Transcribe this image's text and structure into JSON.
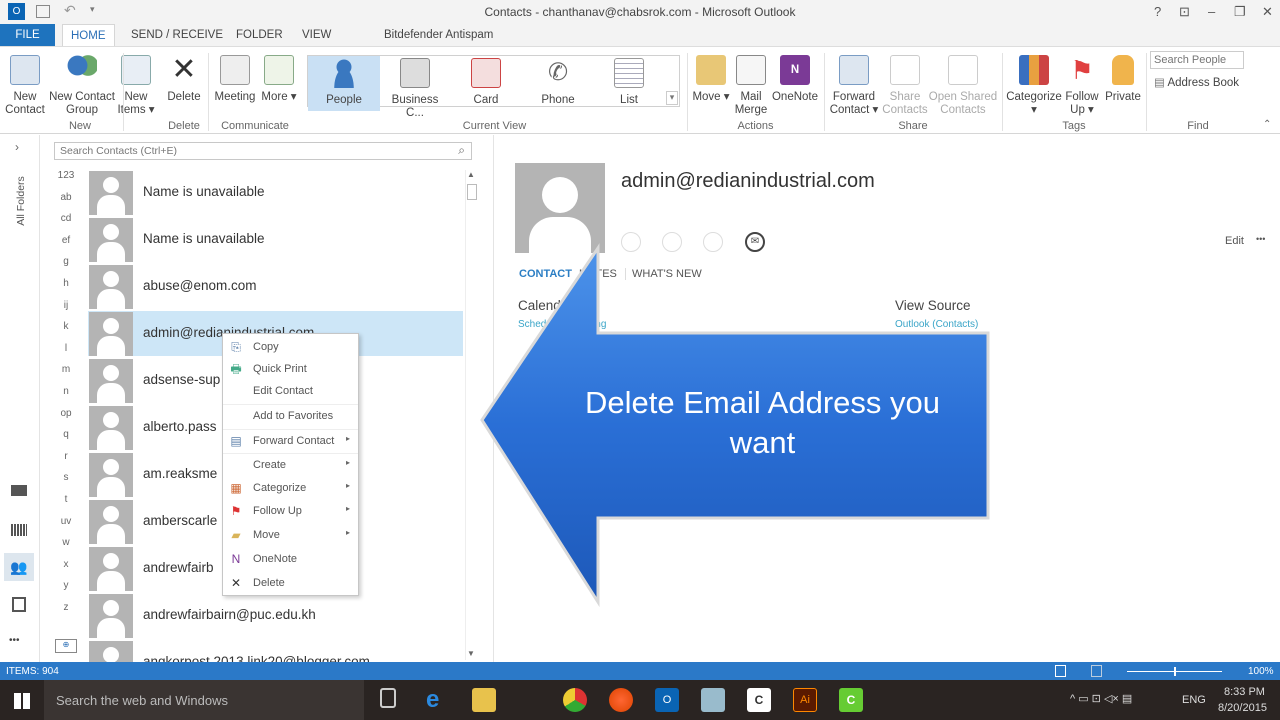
{
  "window": {
    "title": "Contacts - chanthanav@chabsrok.com - Microsoft Outlook",
    "help": "?",
    "ribbon_display": "⊡",
    "minimize": "–",
    "restore": "❐",
    "close": "✕"
  },
  "qat": {
    "app_icon": "O",
    "undo": "↶",
    "customize": "▾"
  },
  "tabs": [
    "FILE",
    "HOME",
    "SEND / RECEIVE",
    "FOLDER",
    "VIEW",
    "Bitdefender Antispam"
  ],
  "ribbon": {
    "new_contact": "New Contact",
    "new_contact_group": "New Contact Group",
    "new_items": "New Items ▾",
    "delete": "Delete",
    "meeting": "Meeting",
    "more": "More ▾",
    "views": [
      "People",
      "Business C...",
      "Card",
      "Phone",
      "List"
    ],
    "move": "Move ▾",
    "mail_merge": "Mail Merge",
    "onenote": "OneNote",
    "forward_contact": "Forward Contact ▾",
    "share_contacts": "Share Contacts",
    "open_shared_contacts": "Open Shared Contacts",
    "categorize": "Categorize ▾",
    "follow_up": "Follow Up ▾",
    "private": "Private",
    "search_people_placeholder": "Search People",
    "address_book": "Address Book",
    "groups": [
      "New",
      "Delete",
      "Communicate",
      "Current View",
      "Actions",
      "Share",
      "Tags",
      "Find"
    ]
  },
  "nav": {
    "all_folders": "All Folders",
    "expand": "›",
    "more": "•••"
  },
  "search": {
    "placeholder": "Search Contacts (Ctrl+E)"
  },
  "alphabet": [
    "123",
    "ab",
    "cd",
    "ef",
    "g",
    "h",
    "ij",
    "k",
    "l",
    "m",
    "n",
    "op",
    "q",
    "r",
    "s",
    "t",
    "uv",
    "w",
    "x",
    "y",
    "z"
  ],
  "contacts": [
    "Name is unavailable",
    "Name is unavailable",
    "abuse@enom.com",
    "admin@redianindustrial.com",
    "adsense-sup",
    "alberto.pass",
    "am.reaksme",
    "amberscarle",
    "andrewfairb",
    "andrewfairbairn@puc.edu.kh",
    "angkorpost 2013.link20@blogger.com"
  ],
  "selected_index": 3,
  "context_menu": [
    {
      "label": "Copy",
      "icon": "copy-icon",
      "glyph": "⎘",
      "submenu": false
    },
    {
      "label": "Quick Print",
      "icon": "print-icon",
      "glyph": "🖶",
      "submenu": false
    },
    {
      "label": "Edit Contact",
      "icon": "",
      "glyph": "",
      "submenu": false
    },
    {
      "label": "Add to Favorites",
      "icon": "",
      "glyph": "",
      "submenu": false
    },
    {
      "label": "Forward Contact",
      "icon": "forward-contact-icon",
      "glyph": "▤",
      "submenu": true
    },
    {
      "label": "Create",
      "icon": "",
      "glyph": "",
      "submenu": true
    },
    {
      "label": "Categorize",
      "icon": "categorize-icon",
      "glyph": "▦",
      "submenu": true
    },
    {
      "label": "Follow Up",
      "icon": "flag-icon",
      "glyph": "⚑",
      "submenu": true
    },
    {
      "label": "Move",
      "icon": "folder-icon",
      "glyph": "▰",
      "submenu": true
    },
    {
      "label": "OneNote",
      "icon": "onenote-icon",
      "glyph": "N",
      "submenu": false
    },
    {
      "label": "Delete",
      "icon": "delete-icon",
      "glyph": "✕",
      "submenu": false
    }
  ],
  "submenu_arrow": "▸",
  "reading_pane": {
    "name": "admin@redianindustrial.com",
    "edit": "Edit",
    "more": "•••",
    "tabs": [
      "CONTACT",
      "NOTES",
      "WHAT'S NEW"
    ],
    "calendar_label": "Calendar",
    "calendar_link": "Schedule a Meeting",
    "view_source_label": "View Source",
    "view_source_link": "Outlook (Contacts)"
  },
  "overlay": {
    "text": "Delete Email Address you want",
    "color": "#2a6fd6"
  },
  "status": {
    "items": "ITEMS: 904",
    "zoom": "100%"
  },
  "taskbar": {
    "search_placeholder": "Search the web and Windows",
    "language": "ENG",
    "time": "8:33 PM",
    "date": "8/20/2015"
  }
}
